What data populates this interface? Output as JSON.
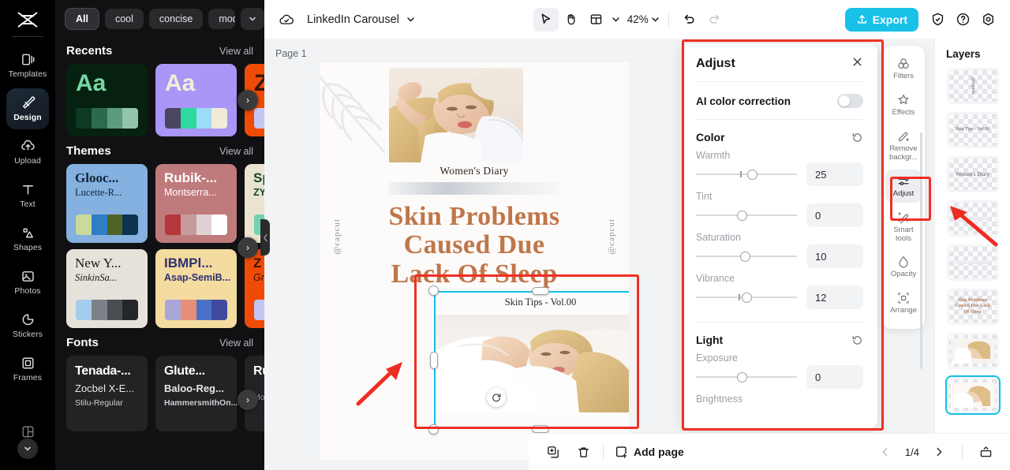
{
  "app": {
    "brand": "capcut-logo"
  },
  "left_rail": {
    "items": [
      {
        "label": "Templates",
        "icon": "templates-icon",
        "active": false
      },
      {
        "label": "Design",
        "icon": "design-icon",
        "active": true
      },
      {
        "label": "Upload",
        "icon": "upload-icon",
        "active": false
      },
      {
        "label": "Text",
        "icon": "text-icon",
        "active": false
      },
      {
        "label": "Shapes",
        "icon": "shapes-icon",
        "active": false
      },
      {
        "label": "Photos",
        "icon": "photos-icon",
        "active": false
      },
      {
        "label": "Stickers",
        "icon": "stickers-icon",
        "active": false
      },
      {
        "label": "Frames",
        "icon": "frames-icon",
        "active": false
      }
    ],
    "more": "chevron-down-icon"
  },
  "panel": {
    "chips": [
      {
        "label": "All",
        "active": true
      },
      {
        "label": "cool",
        "active": false
      },
      {
        "label": "concise",
        "active": false
      },
      {
        "label": "modern",
        "active": false
      }
    ],
    "chip_more": "chevron-down-icon",
    "sections": [
      {
        "title": "Recents",
        "view_all": "View all"
      },
      {
        "title": "Themes",
        "view_all": "View all"
      },
      {
        "title": "Fonts",
        "view_all": "View all"
      }
    ],
    "recents": [
      {
        "sample": "Aa",
        "bg": "#06210f",
        "fg": "#79d6a4",
        "swatches": [
          "#0c3a22",
          "#2b6b4d",
          "#5b9c7e",
          "#93c5ad"
        ]
      },
      {
        "sample": "Aa",
        "bg": "#a996f6",
        "fg": "#f2eedc",
        "swatches": [
          "#4b4660",
          "#2ed9a0",
          "#9ddcf7",
          "#f1ecd8"
        ]
      },
      {
        "sample": "Z",
        "bg": "#f04b06",
        "fg": "#3a1400",
        "swatches": [
          "#c3c6f0",
          "#b8bce9",
          "#a9aee2",
          "#9aa0da"
        ]
      }
    ],
    "themes": [
      {
        "title": "Glooc...",
        "subtitle": "Lucette-R...",
        "bg": "#84b1e0",
        "fg": "#10243a",
        "swatches": [
          "#cbd99a",
          "#2f7ec5",
          "#4f6326",
          "#0c3350"
        ]
      },
      {
        "title": "Rubik-...",
        "subtitle": "Montserra...",
        "bg": "#bf7a7c",
        "fg": "#ffffff",
        "swatches": [
          "#b5373b",
          "#c79b9d",
          "#e0d2d3",
          "#ffffff"
        ]
      },
      {
        "title": "Sp",
        "subtitle": "ZY",
        "bg": "#eae4cf",
        "fg": "#14452f",
        "swatches": [
          "#72d3ae",
          "#72d3ae",
          "#72d3ae",
          "#72d3ae"
        ]
      },
      {
        "title": "New Y...",
        "subtitle": "SinkinSa...",
        "bg": "#e6e2da",
        "fg": "#191919",
        "swatches": [
          "#a5ccee",
          "#7c8287",
          "#4a4e52",
          "#24262a"
        ]
      },
      {
        "title": "IBMPl...",
        "subtitle": "Asap-SemiB...",
        "bg": "#f4dba0",
        "fg": "#2e3171",
        "swatches": [
          "#a8a7d8",
          "#e68f76",
          "#4a71c8",
          "#3e4b9e"
        ]
      },
      {
        "title": "Z",
        "subtitle": "Gro",
        "bg": "#f04b06",
        "fg": "#3a1400",
        "swatches": [
          "#c3c6f0",
          "#b8bce9",
          "#a9aee2",
          "#9aa0da"
        ]
      }
    ],
    "fonts": [
      {
        "line1": "Tenada-...",
        "line2": "Zocbel X-E...",
        "line3": "Stilu-Regular"
      },
      {
        "line1": "Glute...",
        "line2": "Baloo-Reg...",
        "line3": "HammersmithOn..."
      },
      {
        "line1": "Ru",
        "line2": "",
        "line3": "Mor"
      }
    ],
    "next_arrow": "chevron-right-icon",
    "collapse": "chevron-left-icon"
  },
  "topbar": {
    "cloud_icon": "cloud-saved-icon",
    "title": "LinkedIn Carousel",
    "title_caret": "chevron-down-icon",
    "tools": [
      {
        "name": "select-tool",
        "icon": "cursor-icon",
        "active": true
      },
      {
        "name": "hand-tool",
        "icon": "hand-icon",
        "active": false
      },
      {
        "name": "layout-tool",
        "icon": "layout-icon",
        "active": false
      }
    ],
    "zoom": "42%",
    "zoom_caret": "chevron-down-icon",
    "undo": "undo-icon",
    "redo": "redo-icon",
    "export_label": "Export",
    "export_icon": "upload-arrow-icon",
    "export_color": "#18c1e8",
    "shield_icon": "shield-check-icon",
    "help_icon": "question-circle-icon",
    "settings_icon": "gear-icon"
  },
  "canvas": {
    "page_label": "Page 1",
    "copy_icon": "duplicate-page-icon",
    "design": {
      "brand_caption": "Women's Diary",
      "headline_lines": [
        "Skin Problems",
        "Caused Due",
        "Lack Of Sleep"
      ],
      "headline_color": "#c0764a",
      "watermark_left": "@capcut",
      "watermark_right": "@capcut",
      "selected_object_caption": "Skin Tips - Vol.00"
    },
    "float_tools": [
      {
        "name": "crop-icon"
      },
      {
        "name": "replace-icon"
      },
      {
        "name": "duplicate-icon"
      },
      {
        "name": "more-options-icon"
      }
    ],
    "rotate_icon": "rotate-icon",
    "selection_color": "#13c0e8"
  },
  "adjust_panel": {
    "title": "Adjust",
    "close_icon": "close-icon",
    "ai_color_correction": {
      "label": "AI color correction",
      "enabled": false
    },
    "groups": [
      {
        "title": "Color",
        "reset_icon": "reset-icon",
        "sliders": [
          {
            "name": "Warmth",
            "value": "25",
            "pos": 51,
            "tick": 44
          },
          {
            "name": "Tint",
            "value": "0",
            "pos": 41,
            "tick": null
          },
          {
            "name": "Saturation",
            "value": "10",
            "pos": 44,
            "tick": null
          },
          {
            "name": "Vibrance",
            "value": "12",
            "pos": 45,
            "tick": 42
          }
        ]
      },
      {
        "title": "Light",
        "reset_icon": "reset-icon",
        "sliders": [
          {
            "name": "Exposure",
            "value": "0",
            "pos": 41,
            "tick": null
          },
          {
            "name": "Brightness",
            "value": "",
            "pos": 41,
            "tick": null
          }
        ]
      }
    ]
  },
  "tool_rail": {
    "items": [
      {
        "label": "Filters",
        "icon": "filters-icon",
        "active": false
      },
      {
        "label": "Effects",
        "icon": "effects-icon",
        "active": false
      },
      {
        "label": "Remove backgr...",
        "icon": "remove-background-icon",
        "active": false
      },
      {
        "label": "Adjust",
        "icon": "adjust-icon",
        "active": true
      },
      {
        "label": "Smart tools",
        "icon": "smart-tools-icon",
        "active": false
      },
      {
        "label": "Opacity",
        "icon": "opacity-icon",
        "active": false
      },
      {
        "label": "Arrange",
        "icon": "arrange-icon",
        "active": false
      }
    ]
  },
  "layers": {
    "title": "Layers",
    "items": [
      {
        "kind": "text-rot",
        "text": "@capcut",
        "selected": false
      },
      {
        "kind": "text",
        "text": "Skin Tips - Vol.00",
        "selected": false
      },
      {
        "kind": "text",
        "text": "Women's Diary",
        "selected": false
      },
      {
        "kind": "line",
        "text": "",
        "selected": false
      },
      {
        "kind": "line",
        "text": "",
        "selected": false
      },
      {
        "kind": "text",
        "text": "Skin Problems Caused Due Lack Of Sleep",
        "selected": false
      },
      {
        "kind": "photo-a",
        "text": "",
        "selected": false
      },
      {
        "kind": "photo-b",
        "text": "",
        "selected": true
      }
    ]
  },
  "bottombar": {
    "duplicate_icon": "duplicate-icon",
    "delete_icon": "trash-icon",
    "add_page_label": "Add page",
    "add_page_icon": "add-page-icon",
    "prev_icon": "chevron-left-icon",
    "page_indicator": "1/4",
    "next_icon": "chevron-right-icon",
    "present_icon": "present-icon"
  },
  "annotations": {
    "highlight_color": "#ef2f24"
  }
}
